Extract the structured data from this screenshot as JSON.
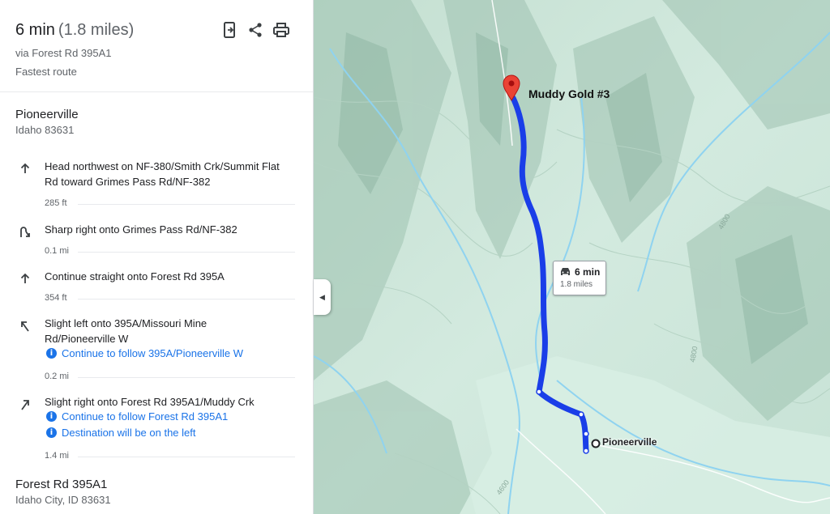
{
  "header": {
    "time": "6 min",
    "distance": "(1.8 miles)",
    "via": "via Forest Rd 395A1",
    "subtitle": "Fastest route",
    "actions": [
      "send-to-phone-icon",
      "share-icon",
      "print-icon"
    ]
  },
  "start": {
    "name": "Pioneerville",
    "address": "Idaho 83631"
  },
  "steps": [
    {
      "icon": "arrow-up-icon",
      "text": "Head northwest on NF-380/Smith Crk/Summit Flat Rd toward Grimes Pass Rd/NF-382",
      "notes": [],
      "distance": "285 ft"
    },
    {
      "icon": "sharp-right-icon",
      "text": "Sharp right onto Grimes Pass Rd/NF-382",
      "notes": [],
      "distance": "0.1 mi"
    },
    {
      "icon": "arrow-up-icon",
      "text": "Continue straight onto Forest Rd 395A",
      "notes": [],
      "distance": "354 ft"
    },
    {
      "icon": "slight-left-icon",
      "text": "Slight left onto 395A/Missouri Mine Rd/Pioneerville W",
      "notes": [
        "Continue to follow 395A/Pioneerville W"
      ],
      "distance": "0.2 mi"
    },
    {
      "icon": "slight-right-icon",
      "text": "Slight right onto Forest Rd 395A1/Muddy Crk",
      "notes": [
        "Continue to follow Forest Rd 395A1",
        "Destination will be on the left"
      ],
      "distance": "1.4 mi"
    }
  ],
  "end": {
    "name": "Forest Rd 395A1",
    "address": "Idaho City, ID 83631"
  },
  "map": {
    "destination_label": "Muddy Gold #3",
    "origin_label": "Pioneerville",
    "eta_time": "6 min",
    "eta_distance": "1.8 miles",
    "collapse_icon": "chevron-left-icon",
    "contour_labels": [
      "4800",
      "4600",
      "4800"
    ],
    "colors": {
      "route": "#1a3ee8",
      "terrain": "#cfe8dc",
      "water": "#8fd3f0",
      "pin": "#ea4335"
    }
  }
}
